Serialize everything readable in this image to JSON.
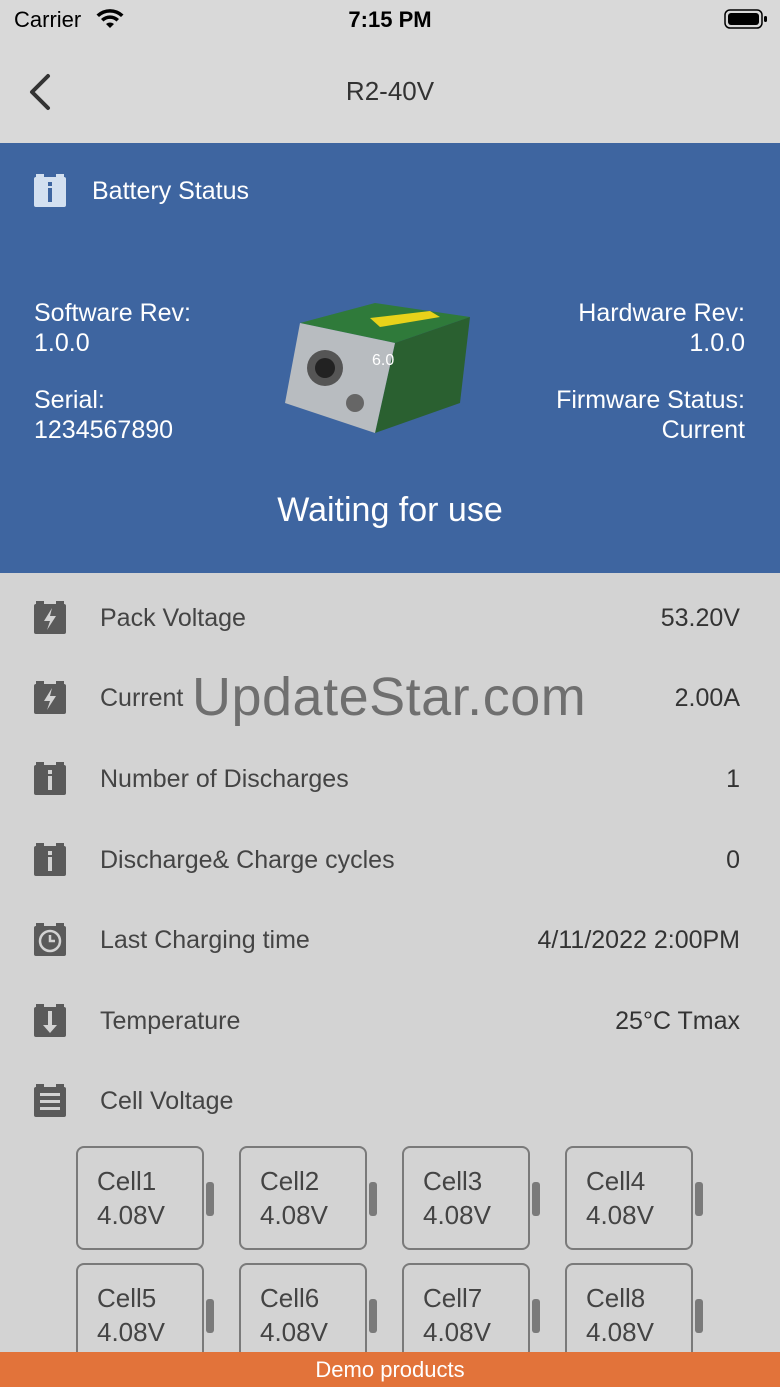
{
  "status_bar": {
    "carrier": "Carrier",
    "time": "7:15 PM"
  },
  "nav": {
    "title": "R2-40V"
  },
  "hero": {
    "header_label": "Battery Status",
    "software_rev_label": "Software Rev:",
    "software_rev_value": "1.0.0",
    "serial_label": "Serial:",
    "serial_value": "1234567890",
    "hardware_rev_label": "Hardware Rev:",
    "hardware_rev_value": "1.0.0",
    "firmware_status_label": "Firmware Status:",
    "firmware_status_value": "Current",
    "device_badge": "6.0",
    "state": "Waiting for use"
  },
  "rows": [
    {
      "icon": "bolt-icon",
      "label": "Pack Voltage",
      "value": "53.20V"
    },
    {
      "icon": "bolt-icon",
      "label": "Current",
      "value": "2.00A"
    },
    {
      "icon": "info-icon",
      "label": "Number of Discharges",
      "value": "1"
    },
    {
      "icon": "info-icon",
      "label": "Discharge& Charge cycles",
      "value": "0"
    },
    {
      "icon": "clock-icon",
      "label": "Last Charging time",
      "value": "4/11/2022 2:00PM"
    },
    {
      "icon": "down-arrow-icon",
      "label": "Temperature",
      "value": "25°C Tmax"
    },
    {
      "icon": "list-icon",
      "label": "Cell Voltage",
      "value": ""
    }
  ],
  "watermark": "UpdateStar.com",
  "cells": [
    {
      "name": "Cell1",
      "voltage": "4.08V"
    },
    {
      "name": "Cell2",
      "voltage": "4.08V"
    },
    {
      "name": "Cell3",
      "voltage": "4.08V"
    },
    {
      "name": "Cell4",
      "voltage": "4.08V"
    },
    {
      "name": "Cell5",
      "voltage": "4.08V"
    },
    {
      "name": "Cell6",
      "voltage": "4.08V"
    },
    {
      "name": "Cell7",
      "voltage": "4.08V"
    },
    {
      "name": "Cell8",
      "voltage": "4.08V"
    }
  ],
  "footer": {
    "label": "Demo products"
  },
  "colors": {
    "hero_bg": "#3e65a0",
    "footer_bg": "#e2733a",
    "page_bg": "#d3d3d3"
  }
}
